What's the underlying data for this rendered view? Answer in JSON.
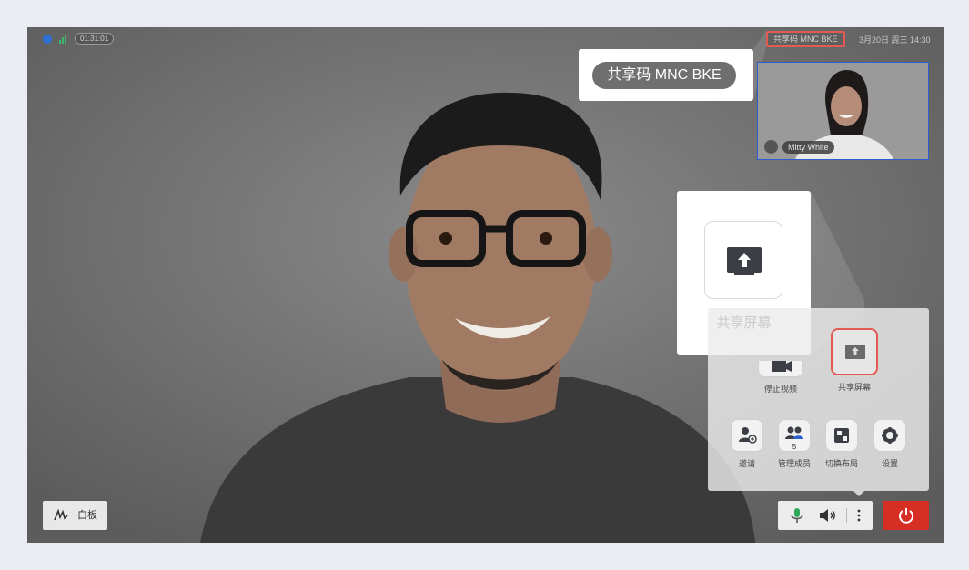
{
  "topbar": {
    "timer": "01:31:01",
    "share_code_small": "共享码 MNC BKE",
    "datetime": "3月20日 周三 14:30"
  },
  "callout_code": {
    "text": "共享码 MNC BKE"
  },
  "thumbnail": {
    "name": "Mitty White"
  },
  "callout_share": {
    "label": "共享屏幕"
  },
  "menu": {
    "stop_video": "停止视频",
    "share_screen": "共享屏幕",
    "invite": "邀请",
    "manage_members": "管理成员",
    "members_count": "5",
    "switch_layout": "切换布局",
    "settings": "设置"
  },
  "bottom": {
    "whiteboard": "白板"
  },
  "colors": {
    "accent_red": "#d62d25",
    "highlight": "#e35a52",
    "mic_green": "#2fa85a",
    "blue_border": "#2c5fd1"
  },
  "icons": [
    "shield-icon",
    "signal-icon",
    "mic-icon",
    "speaker-icon",
    "more-icon",
    "power-icon",
    "share-screen-icon",
    "invite-icon",
    "members-icon",
    "layout-icon",
    "gear-icon",
    "pen-icon",
    "video-icon"
  ]
}
